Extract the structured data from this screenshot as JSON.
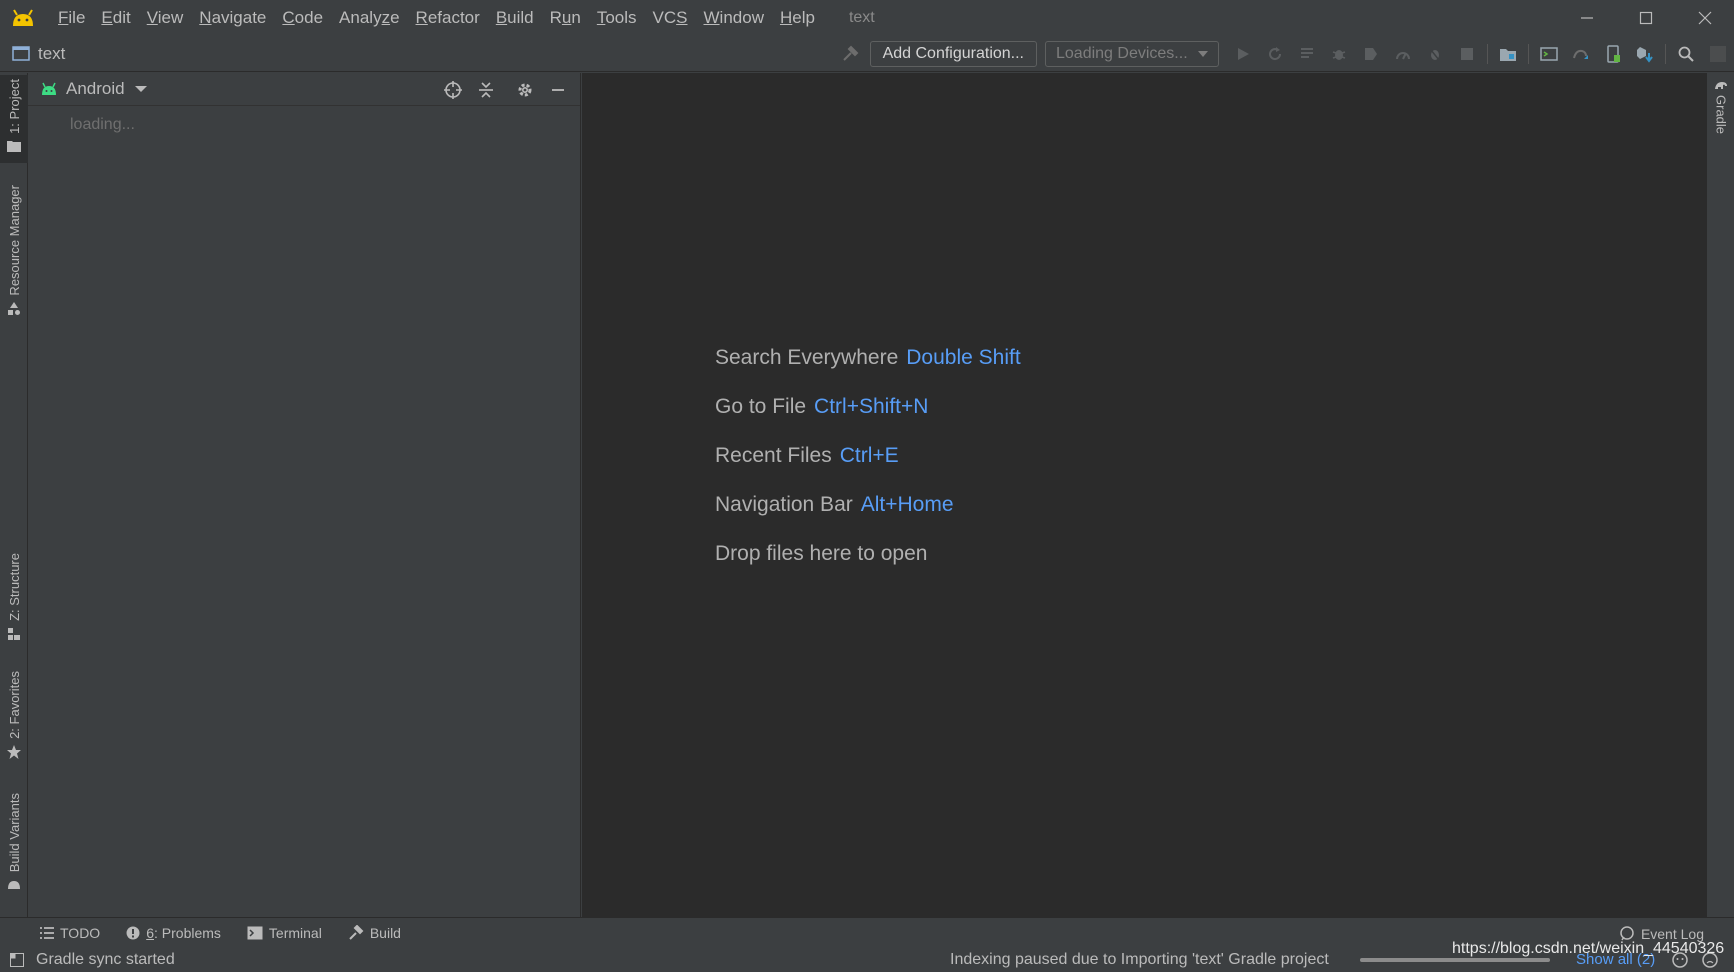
{
  "menu": {
    "items": [
      {
        "pre": "",
        "mn": "F",
        "post": "ile"
      },
      {
        "pre": "",
        "mn": "E",
        "post": "dit"
      },
      {
        "pre": "",
        "mn": "V",
        "post": "iew"
      },
      {
        "pre": "",
        "mn": "N",
        "post": "avigate"
      },
      {
        "pre": "",
        "mn": "C",
        "post": "ode"
      },
      {
        "pre": "Analy",
        "mn": "z",
        "post": "e"
      },
      {
        "pre": "",
        "mn": "R",
        "post": "efactor"
      },
      {
        "pre": "",
        "mn": "B",
        "post": "uild"
      },
      {
        "pre": "R",
        "mn": "u",
        "post": "n"
      },
      {
        "pre": "",
        "mn": "T",
        "post": "ools"
      },
      {
        "pre": "VC",
        "mn": "S",
        "post": ""
      },
      {
        "pre": "",
        "mn": "W",
        "post": "indow"
      },
      {
        "pre": "",
        "mn": "H",
        "post": "elp"
      }
    ],
    "window_title": "text"
  },
  "toolbar": {
    "project_name": "text",
    "config_button": "Add Configuration...",
    "devices_dropdown": "Loading Devices..."
  },
  "left_tabs": {
    "project": "1: Project",
    "resource_manager": "Resource Manager",
    "structure": "Z: Structure",
    "favorites": "2: Favorites",
    "build_variants": "Build Variants"
  },
  "right_tabs": {
    "gradle": "Gradle"
  },
  "project_panel": {
    "view_mode": "Android",
    "loading": "loading..."
  },
  "editor": {
    "hints": [
      {
        "label": "Search Everywhere",
        "key": "Double Shift"
      },
      {
        "label": "Go to File",
        "key": "Ctrl+Shift+N"
      },
      {
        "label": "Recent Files",
        "key": "Ctrl+E"
      },
      {
        "label": "Navigation Bar",
        "key": "Alt+Home"
      },
      {
        "label": "Drop files here to open",
        "key": ""
      }
    ]
  },
  "bottom_tabs": {
    "todo": "TODO",
    "problems_mn": "6",
    "problems_rest": ": Problems",
    "terminal": "Terminal",
    "build": "Build",
    "event_log": "Event Log"
  },
  "statusbar": {
    "left_text": "Gradle sync started",
    "indexing_text": "Indexing paused due to Importing 'text' Gradle project",
    "show_all": "Show all (2)",
    "progress": 1.0,
    "watermark": "https://blog.csdn.net/weixin_44540326"
  },
  "colors": {
    "background": "#3c3f41",
    "editor_bg": "#2b2b2b",
    "accent_blue": "#589df6",
    "android_green": "#3ddc84",
    "logo_yellow": "#f4c400"
  },
  "icons": {
    "logo": "android-studio-logo-icon",
    "minimize": "minimize-icon",
    "maximize": "maximize-icon",
    "close": "close-icon"
  }
}
